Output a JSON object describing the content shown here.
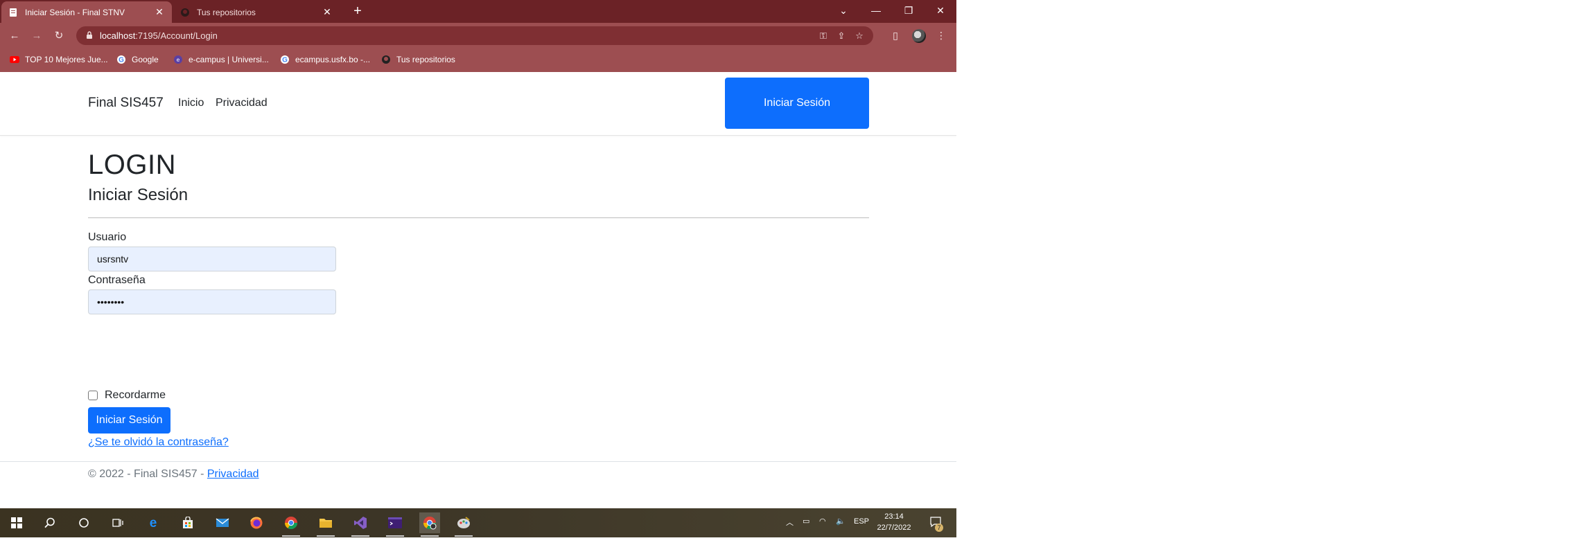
{
  "browser": {
    "tabs": [
      {
        "title": "Iniciar Sesión - Final STNV",
        "active": true
      },
      {
        "title": "Tus repositorios",
        "active": false
      }
    ],
    "new_tab": "+",
    "window_controls": {
      "minimize": "—",
      "restore": "❐",
      "close": "✕",
      "tab_search": "⌄"
    },
    "url": {
      "host": "localhost",
      "rest": ":7195/Account/Login"
    },
    "bookmarks": [
      {
        "label": "TOP 10 Mejores Jue...",
        "icon": "youtube-icon"
      },
      {
        "label": "Google",
        "icon": "google-icon"
      },
      {
        "label": "e-campus | Universi...",
        "icon": "ecampus-icon"
      },
      {
        "label": "ecampus.usfx.bo -...",
        "icon": "google-icon"
      },
      {
        "label": "Tus repositorios",
        "icon": "github-icon"
      }
    ]
  },
  "site": {
    "brand": "Final SIS457",
    "nav": [
      "Inicio",
      "Privacidad"
    ],
    "header_login_label": "Iniciar Sesión"
  },
  "login": {
    "heading": "LOGIN",
    "subheading": "Iniciar Sesión",
    "username_label": "Usuario",
    "username_value": "usrsntv",
    "password_label": "Contraseña",
    "password_value": "••••••••",
    "remember_label": "Recordarme",
    "remember_checked": false,
    "submit_label": "Iniciar Sesión",
    "forgot_link": "¿Se te olvidó la contraseña?"
  },
  "footer": {
    "text": "© 2022 - Final SIS457 - ",
    "link": "Privacidad"
  },
  "taskbar": {
    "language": "ESP",
    "time": "23:14",
    "date": "22/7/2022",
    "notification_count": "7"
  },
  "colors": {
    "tabstrip": "#6b2226",
    "toolbar": "#9d4e51",
    "primary": "#0d6efd",
    "input_autofill": "#e8f0fe"
  }
}
